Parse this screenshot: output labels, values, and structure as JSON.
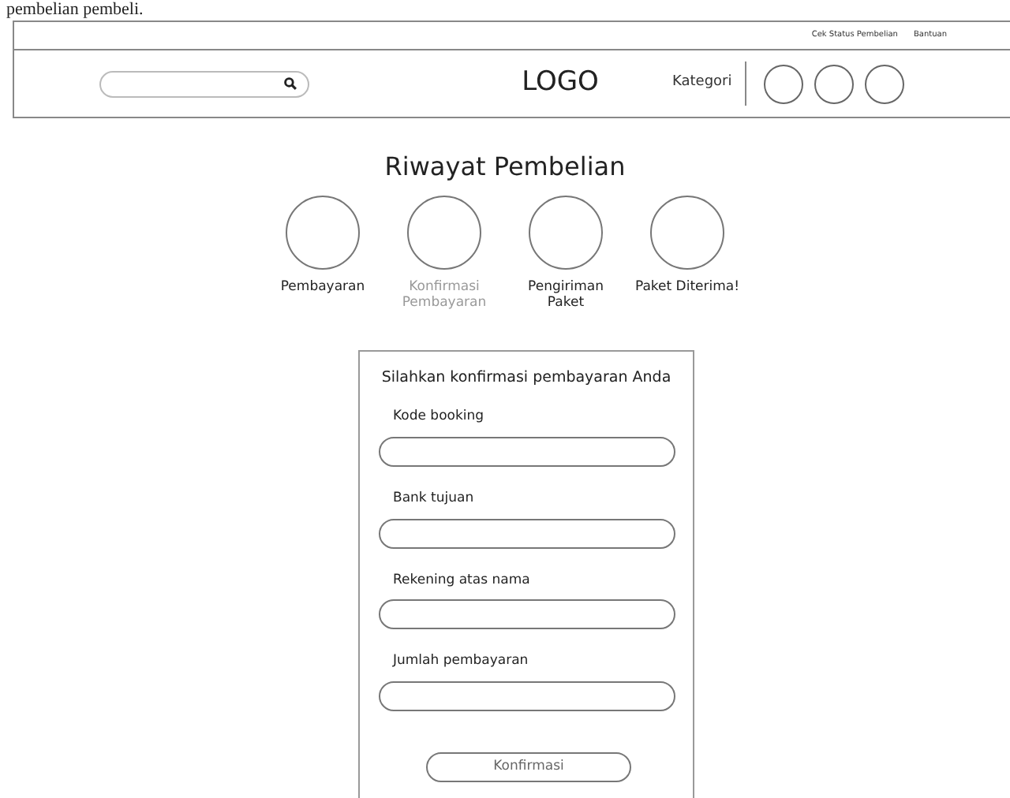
{
  "caption": "pembelian pembeli.",
  "header": {
    "top_links": [
      "Cek Status Pembelian",
      "Bantuan"
    ],
    "logo": "LOGO",
    "category": "Kategori"
  },
  "history": {
    "title": "Riwayat Pembelian",
    "steps": [
      {
        "label": "Pembayaran",
        "muted": false
      },
      {
        "label": "Konfirmasi Pembayaran",
        "muted": true
      },
      {
        "label": "Pengiriman Paket",
        "muted": false
      },
      {
        "label": "Paket Diterima!",
        "muted": false
      }
    ]
  },
  "form": {
    "title": "Silahkan konfirmasi pembayaran Anda",
    "fields": [
      {
        "label": "Kode booking"
      },
      {
        "label": "Bank tujuan"
      },
      {
        "label": "Rekening atas nama"
      },
      {
        "label": "Jumlah pembayaran"
      }
    ],
    "button": "Konfirmasi"
  }
}
